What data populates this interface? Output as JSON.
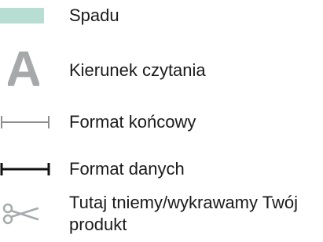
{
  "legend": {
    "items": [
      {
        "icon": "bleed-swatch-icon",
        "label": "Spadu"
      },
      {
        "icon": "reading-direction-icon",
        "label": "Kierunek czytania"
      },
      {
        "icon": "final-format-icon",
        "label": "Format końcowy"
      },
      {
        "icon": "data-format-icon",
        "label": "Format danych"
      },
      {
        "icon": "scissors-icon",
        "label": "Tutaj tniemy/wykrawamy Twój produkt"
      }
    ],
    "reading_direction_glyph": "A"
  },
  "colors": {
    "bleed": "#b8ddd3",
    "reading_glyph": "#a6a8aa",
    "final_format_line": "#8e8e8e",
    "data_format_line": "#111111",
    "scissors": "#a7aaab",
    "text": "#1a1a1a"
  }
}
